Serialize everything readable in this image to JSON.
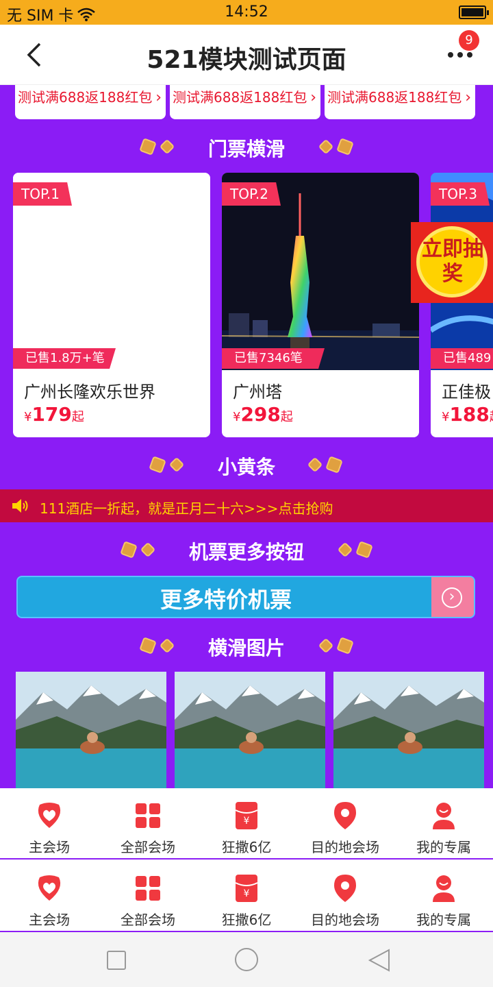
{
  "status_bar": {
    "carrier": "无 SIM 卡",
    "time": "14:52"
  },
  "header": {
    "title": "521模块测试页面",
    "badge_count": "9"
  },
  "coupons": [
    {
      "text": "测试满688返188红包"
    },
    {
      "text": "测试满688返188红包"
    },
    {
      "text": "测试满688返188红包"
    }
  ],
  "sections": {
    "tickets": "门票横滑",
    "yellow_bar": "小黄条",
    "flight": "机票更多按钮",
    "pictures": "横滑图片"
  },
  "tickets": [
    {
      "rank": "TOP.1",
      "sold": "已售1.8万+笔",
      "name": "广州长隆欢乐世界",
      "currency": "¥",
      "price": "179",
      "suffix": "起"
    },
    {
      "rank": "TOP.2",
      "sold": "已售7346笔",
      "name": "广州塔",
      "currency": "¥",
      "price": "298",
      "suffix": "起"
    },
    {
      "rank": "TOP.3",
      "sold": "已售489",
      "name": "正佳极",
      "currency": "¥",
      "price": "188",
      "suffix": "起"
    }
  ],
  "lottery": {
    "label": "立即抽奖"
  },
  "notice": {
    "text": "111酒店一折起，就是正月二十六>>>点击抢购"
  },
  "flight_button": {
    "label": "更多特价机票"
  },
  "tabbars": [
    {
      "tabs": [
        {
          "label": "主会场",
          "icon": "heart-icon"
        },
        {
          "label": "全部会场",
          "icon": "grid-icon"
        },
        {
          "label": "狂撒6亿",
          "icon": "red-envelope-icon"
        },
        {
          "label": "目的地会场",
          "icon": "location-pin-icon"
        },
        {
          "label": "我的专属",
          "icon": "user-icon"
        }
      ]
    },
    {
      "tabs": [
        {
          "label": "主会场",
          "icon": "heart-icon"
        },
        {
          "label": "全部会场",
          "icon": "grid-icon"
        },
        {
          "label": "狂撒6亿",
          "icon": "red-envelope-icon"
        },
        {
          "label": "目的地会场",
          "icon": "location-pin-icon"
        },
        {
          "label": "我的专属",
          "icon": "user-icon"
        }
      ]
    }
  ],
  "colors": {
    "accent": "#8b1cf5",
    "price": "#f2153a",
    "status_bar": "#f6ac1c"
  }
}
